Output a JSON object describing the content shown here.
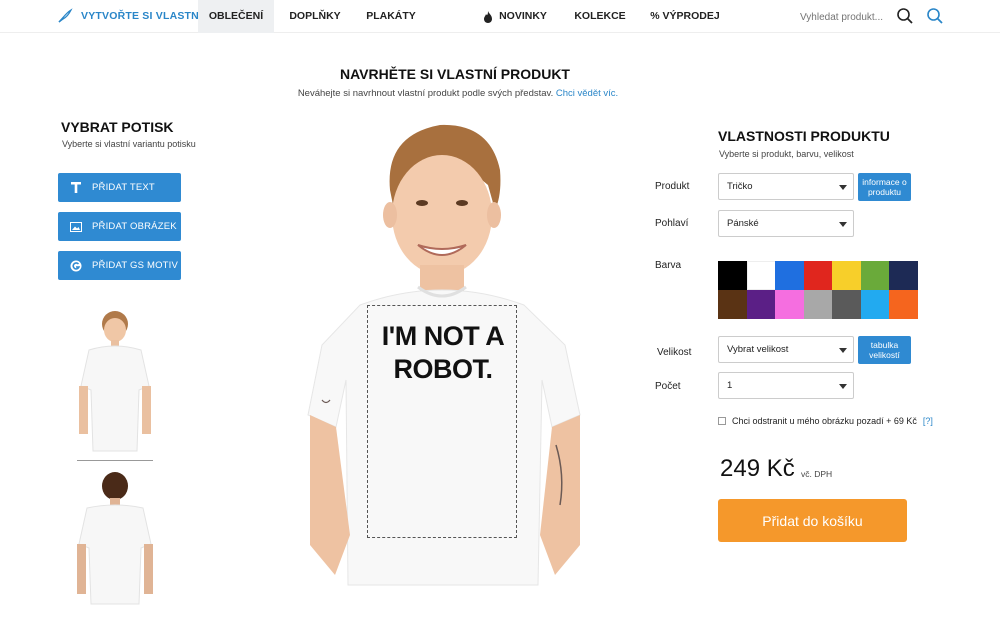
{
  "header": {
    "logo_text": "VYTVOŘTE SI VLASTNÍ",
    "nav": [
      {
        "label": "OBLEČENÍ",
        "active": true
      },
      {
        "label": "DOPLŇKY"
      },
      {
        "label": "PLAKÁTY"
      },
      {
        "label": "NOVINKY",
        "icon": "flame-icon"
      },
      {
        "label": "KOLEKCE"
      },
      {
        "label": "% VÝPRODEJ"
      }
    ],
    "search_placeholder": "Vyhledat produkt..."
  },
  "hero": {
    "title": "NAVRHĚTE SI VLASTNÍ PRODUKT",
    "subtitle": "Neváhejte si navrhnout vlastní produkt podle svých představ.",
    "link": "Chci vědět víc."
  },
  "left_panel": {
    "title": "VYBRAT POTISK",
    "subtitle": "Vyberte si vlastní variantu potisku",
    "buttons": [
      {
        "label": "PŘIDAT TEXT",
        "icon": "text-icon"
      },
      {
        "label": "PŘIDAT OBRÁZEK",
        "icon": "image-icon"
      },
      {
        "label": "PŘIDAT GS MOTIV",
        "icon": "gs-logo-icon"
      }
    ]
  },
  "design": {
    "print_text_line1": "I'M NOT A",
    "print_text_line2": "ROBOT."
  },
  "right_panel": {
    "title": "VLASTNOSTI PRODUKTU",
    "subtitle": "Vyberte si produkt, barvu, velikost",
    "product_label": "Produkt",
    "product_value": "Tričko",
    "product_info_btn": "informace o produktu",
    "gender_label": "Pohlaví",
    "gender_value": "Pánské",
    "color_label": "Barva",
    "colors": [
      "#000000",
      "#ffffff",
      "#1f6fe0",
      "#e0261e",
      "#f7cf2a",
      "#6aaa3a",
      "#1d2a55",
      "#5a3314",
      "#5b1f86",
      "#f56ee0",
      "#a8a8a8",
      "#5a5a5a",
      "#22aaf0",
      "#f5651e"
    ],
    "size_label": "Velikost",
    "size_value": "Vybrat velikost",
    "size_table_btn": "tabulka velikostí",
    "qty_label": "Počet",
    "qty_value": "1",
    "bg_remove_text": "Chci odstranit u mého obrázku pozadí + 69 Kč",
    "bg_remove_help": "[?]",
    "price": "249 Kč",
    "vat": "vč. DPH",
    "cart_btn": "Přidat do košíku"
  }
}
